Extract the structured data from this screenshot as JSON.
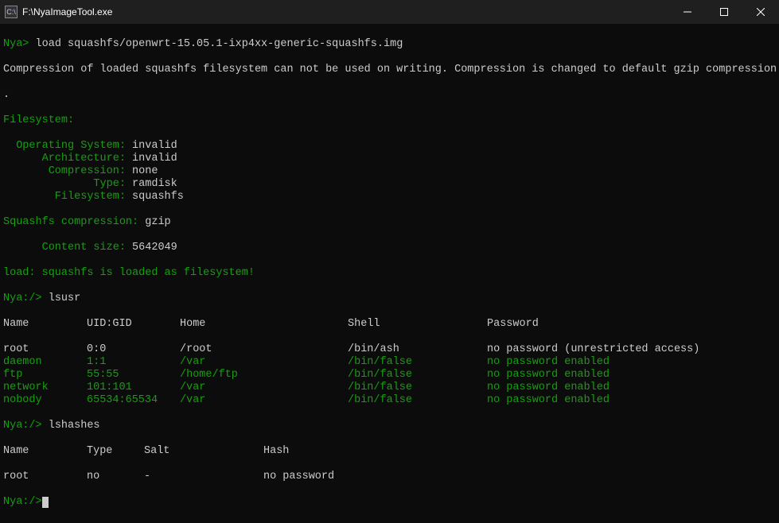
{
  "window": {
    "title": "F:\\NyaImageTool.exe",
    "icon_label": "C:\\"
  },
  "prompt1": {
    "prefix": "Nya> ",
    "command": "load squashfs/openwrt-15.05.1-ixp4xx-generic-squashfs.img"
  },
  "warning_line1": "Compression of loaded squashfs filesystem can not be used on writing. Compression is changed to default gzip compression",
  "warning_line2": ".",
  "fs_header": "Filesystem:",
  "fs": [
    {
      "label": "  Operating System:",
      "value": " invalid"
    },
    {
      "label": "      Architecture:",
      "value": " invalid"
    },
    {
      "label": "       Compression:",
      "value": " none"
    },
    {
      "label": "              Type:",
      "value": " ramdisk"
    },
    {
      "label": "        Filesystem:",
      "value": " squashfs"
    }
  ],
  "squashfs_comp": {
    "label": "Squashfs compression:",
    "value": " gzip"
  },
  "content_size": {
    "label": "      Content size:",
    "value": " 5642049"
  },
  "load_msg": "load: squashfs is loaded as filesystem!",
  "prompt2": {
    "prefix": "Nya:/> ",
    "command": "lsusr"
  },
  "usr_header": {
    "name": "Name",
    "uid": "UID:GID",
    "home": "Home",
    "shell": "Shell",
    "pass": "Password"
  },
  "users": [
    {
      "name": "root",
      "uid": "0:0",
      "home": "/root",
      "shell": "/bin/ash",
      "pass": "no password (unrestricted access)",
      "highlight": true
    },
    {
      "name": "daemon",
      "uid": "1:1",
      "home": "/var",
      "shell": "/bin/false",
      "pass": "no password enabled",
      "highlight": false
    },
    {
      "name": "ftp",
      "uid": "55:55",
      "home": "/home/ftp",
      "shell": "/bin/false",
      "pass": "no password enabled",
      "highlight": false
    },
    {
      "name": "network",
      "uid": "101:101",
      "home": "/var",
      "shell": "/bin/false",
      "pass": "no password enabled",
      "highlight": false
    },
    {
      "name": "nobody",
      "uid": "65534:65534",
      "home": "/var",
      "shell": "/bin/false",
      "pass": "no password enabled",
      "highlight": false
    }
  ],
  "prompt3": {
    "prefix": "Nya:/> ",
    "command": "lshashes"
  },
  "hash_header": {
    "name": "Name",
    "type": "Type",
    "salt": "Salt",
    "hash": "Hash"
  },
  "hashes": [
    {
      "name": "root",
      "type": "no",
      "salt": "-",
      "hash": "no password"
    }
  ],
  "prompt4": {
    "prefix": "Nya:/>"
  }
}
